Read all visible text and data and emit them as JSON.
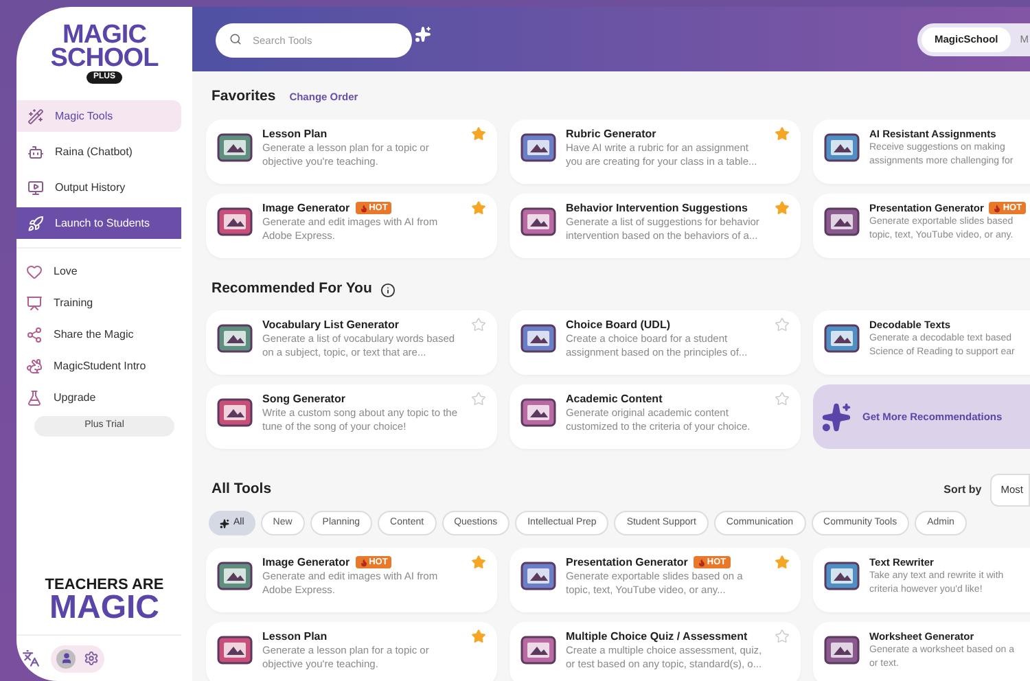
{
  "sidebar": {
    "logo": {
      "line1": "MAGIC",
      "line2": "SCHOOL",
      "badge": "PLUS"
    },
    "primary_items": [
      {
        "label": "Magic Tools",
        "kind": "nav",
        "selected": true
      },
      {
        "label": "Raina (Chatbot)",
        "kind": "nav",
        "selected": false
      },
      {
        "label": "Output History",
        "kind": "nav",
        "selected": false
      },
      {
        "label": "Launch to Students",
        "kind": "launch",
        "selected": false
      }
    ],
    "secondary_items": [
      "Love",
      "Training",
      "Share the Magic",
      "MagicStudent Intro",
      "Upgrade"
    ],
    "trial_button": "Plus Trial",
    "slogan": {
      "line1": "TEACHERS ARE",
      "line2": "MAGIC"
    }
  },
  "header": {
    "search": {
      "placeholder": "Search Tools"
    },
    "switch": [
      {
        "label": "MagicSchool",
        "selected": true
      },
      {
        "label": "M",
        "selected": false
      }
    ]
  },
  "favorites": {
    "title": "Favorites",
    "link": "Change Order",
    "cards": [
      {
        "title": "Lesson Plan",
        "description": [
          "Generate a lesson plan for a topic or",
          "objective you're teaching."
        ],
        "starred": true
      },
      {
        "title": "Rubric Generator",
        "description": [
          "Have AI write a rubric for an assignment",
          "you are creating for your class in a table..."
        ],
        "starred": true
      },
      {
        "title": "AI Resistant Assignments",
        "description": [
          "Receive suggestions on making",
          "assignments more challenging for"
        ]
      },
      {
        "title": "Image Generator",
        "badge": "HOT",
        "description": [
          "Generate and edit images with AI from",
          "Adobe Express."
        ],
        "starred": true
      },
      {
        "title": "Behavior Intervention Suggestions",
        "description": [
          "Generate a list of suggestions for behavior",
          "intervention based on the behaviors of a..."
        ],
        "starred": true
      },
      {
        "title": "Presentation Generator",
        "badge": "HOT",
        "description": [
          "Generate exportable slides based",
          "topic, text, YouTube video, or any."
        ]
      }
    ]
  },
  "recommended": {
    "title": "Recommended For You",
    "cards": [
      {
        "title": "Vocabulary List Generator",
        "description": [
          "Generate a list of vocabulary words based",
          "on a subject, topic, or text that are..."
        ],
        "starred": false
      },
      {
        "title": "Choice Board (UDL)",
        "description": [
          "Create a choice board for a student",
          "assignment based on the principles of..."
        ],
        "starred": false
      },
      {
        "title": "Decodable Texts",
        "description": [
          "Generate a decodable text based",
          "Science of Reading to support ear"
        ]
      },
      {
        "title": "Song Generator",
        "description": [
          "Write a custom song about any topic to the",
          "tune of the song of your choice!"
        ],
        "starred": false
      },
      {
        "title": "Academic Content",
        "description": [
          "Generate original academic content",
          "customized to the criteria of your choice."
        ],
        "starred": false
      }
    ],
    "more_button": "Get More Recommendations"
  },
  "all_tools": {
    "title": "All Tools",
    "sort_label": "Sort by",
    "sort_value": "Most",
    "filters": [
      {
        "label": "All",
        "selected": true
      },
      {
        "label": "New",
        "selected": false
      },
      {
        "label": "Planning",
        "selected": false
      },
      {
        "label": "Content",
        "selected": false
      },
      {
        "label": "Questions",
        "selected": false
      },
      {
        "label": "Intellectual Prep",
        "selected": false
      },
      {
        "label": "Student Support",
        "selected": false
      },
      {
        "label": "Communication",
        "selected": false
      },
      {
        "label": "Community Tools",
        "selected": false
      },
      {
        "label": "Admin",
        "selected": false
      }
    ],
    "cards": [
      {
        "title": "Image Generator",
        "badge": "HOT",
        "description": [
          "Generate and edit images with AI from",
          "Adobe Express."
        ],
        "starred": true
      },
      {
        "title": "Presentation Generator",
        "badge": "HOT",
        "description": [
          "Generate exportable slides based on a",
          "topic, text, YouTube video, or any..."
        ],
        "starred": true
      },
      {
        "title": "Text Rewriter",
        "description": [
          "Take any text and rewrite it with",
          "criteria however you'd like!"
        ]
      },
      {
        "title": "Lesson Plan",
        "description": [
          "Generate a lesson plan for a topic or",
          "objective you're teaching."
        ],
        "starred": true
      },
      {
        "title": "Multiple Choice Quiz / Assessment",
        "description": [
          "Create a multiple choice assessment, quiz,",
          "or test based on any topic, standard(s), o..."
        ],
        "starred": false
      },
      {
        "title": "Worksheet Generator",
        "description": [
          "Generate a worksheet based on a",
          "or text."
        ]
      }
    ]
  }
}
